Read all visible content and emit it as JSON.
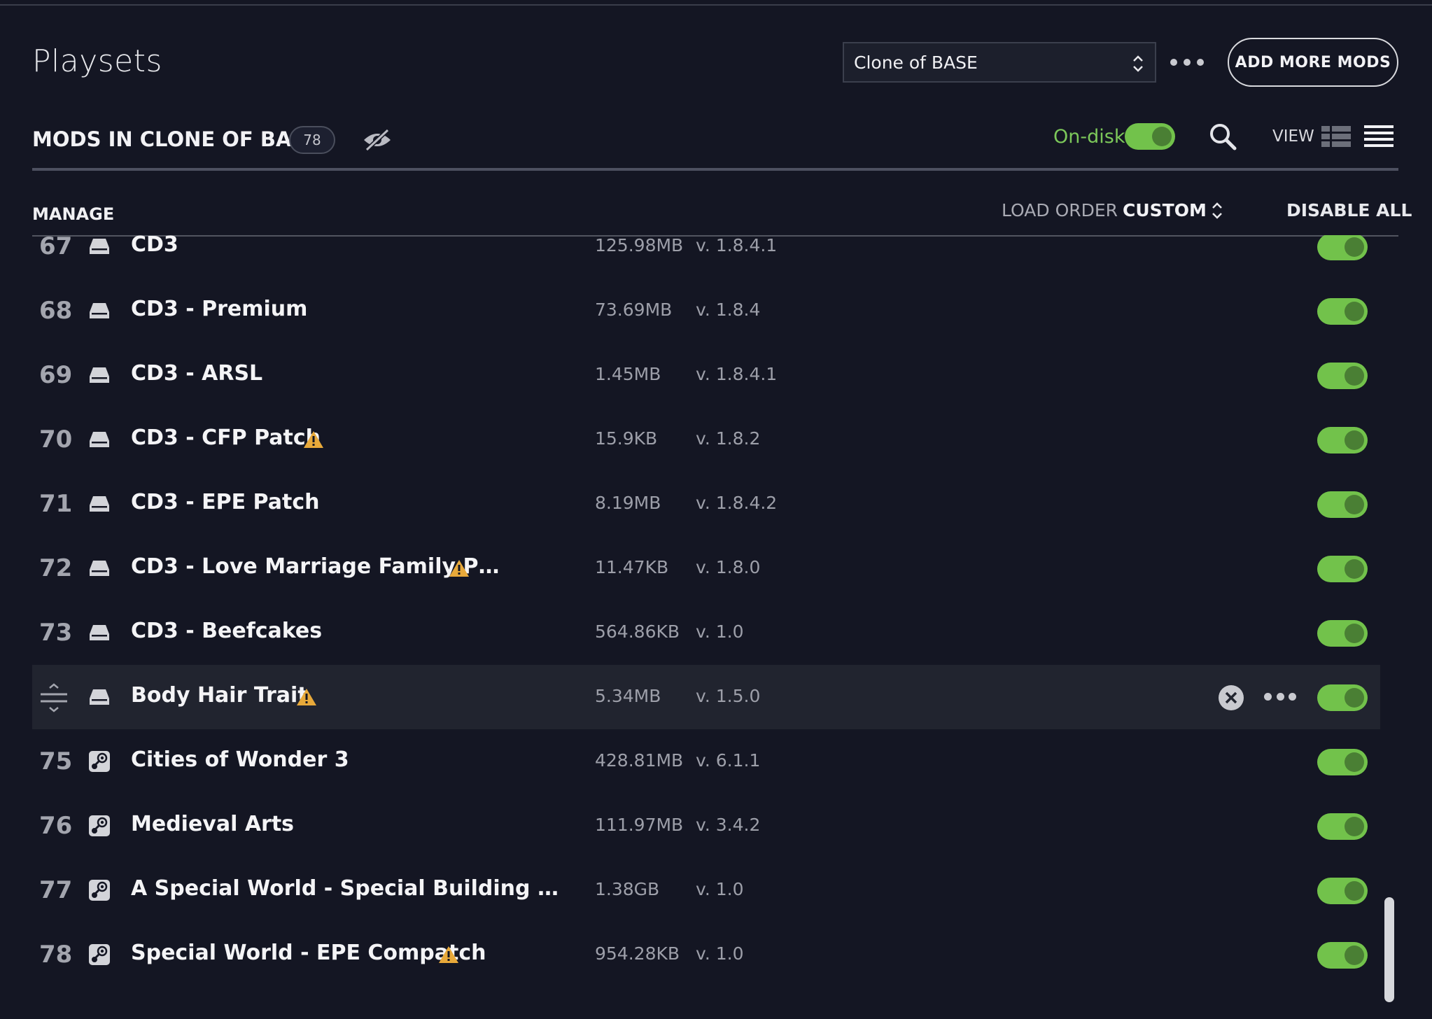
{
  "header": {
    "title": "Playsets",
    "playset_selected": "Clone of BASE",
    "add_mods_label": "ADD MORE MODS"
  },
  "subheader": {
    "mods_heading": "MODS IN CLONE OF BASE",
    "mod_count": "78",
    "ondisk_label": "On-disk",
    "ondisk_enabled": true,
    "view_label": "VIEW"
  },
  "list_header": {
    "manage_label": "MANAGE",
    "load_order_label": "LOAD ORDER",
    "load_order_value": "CUSTOM",
    "disable_all_label": "DISABLE ALL"
  },
  "colors": {
    "accent_green": "#72c24b",
    "warning": "#e8a93a",
    "background": "#141623"
  },
  "mods": [
    {
      "num": "67",
      "name": "CD3",
      "size": "125.98MB",
      "version": "v. 1.8.4.1",
      "source": "disk-icon",
      "warning": false,
      "enabled": true
    },
    {
      "num": "68",
      "name": "CD3 - Premium",
      "size": "73.69MB",
      "version": "v. 1.8.4",
      "source": "disk-icon",
      "warning": false,
      "enabled": true
    },
    {
      "num": "69",
      "name": "CD3 - ARSL",
      "size": "1.45MB",
      "version": "v. 1.8.4.1",
      "source": "disk-icon",
      "warning": false,
      "enabled": true
    },
    {
      "num": "70",
      "name": "CD3 - CFP Patch",
      "size": "15.9KB",
      "version": "v. 1.8.2",
      "source": "disk-icon",
      "warning": true,
      "enabled": true
    },
    {
      "num": "71",
      "name": "CD3 - EPE Patch",
      "size": "8.19MB",
      "version": "v. 1.8.4.2",
      "source": "disk-icon",
      "warning": false,
      "enabled": true
    },
    {
      "num": "72",
      "name": "CD3 - Love Marriage Family P…",
      "size": "11.47KB",
      "version": "v. 1.8.0",
      "source": "disk-icon",
      "warning": true,
      "enabled": true
    },
    {
      "num": "73",
      "name": "CD3 - Beefcakes",
      "size": "564.86KB",
      "version": "v. 1.0",
      "source": "disk-icon",
      "warning": false,
      "enabled": true
    },
    {
      "num": "",
      "name": "Body Hair Trait",
      "size": "5.34MB",
      "version": "v. 1.5.0",
      "source": "disk-icon",
      "warning": true,
      "enabled": true,
      "selected": true
    },
    {
      "num": "75",
      "name": "Cities of Wonder 3",
      "size": "428.81MB",
      "version": "v. 6.1.1",
      "source": "steam-icon",
      "warning": false,
      "enabled": true
    },
    {
      "num": "76",
      "name": "Medieval Arts",
      "size": "111.97MB",
      "version": "v. 3.4.2",
      "source": "steam-icon",
      "warning": false,
      "enabled": true
    },
    {
      "num": "77",
      "name": "A Special World - Special Building …",
      "size": "1.38GB",
      "version": "v. 1.0",
      "source": "steam-icon",
      "warning": false,
      "enabled": true
    },
    {
      "num": "78",
      "name": "Special World - EPE Compatch",
      "size": "954.28KB",
      "version": "v. 1.0",
      "source": "steam-icon",
      "warning": true,
      "enabled": true
    }
  ]
}
